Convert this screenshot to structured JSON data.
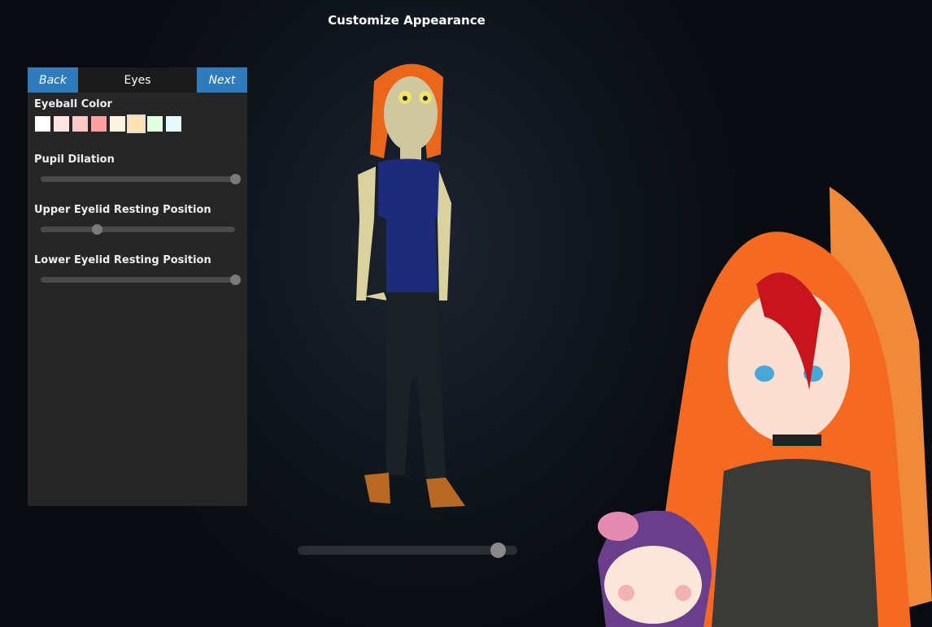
{
  "header": {
    "title": "Customize Appearance"
  },
  "panel": {
    "back_label": "Back",
    "section_title": "Eyes",
    "next_label": "Next",
    "eyeball_color": {
      "label": "Eyeball Color",
      "selected_index": 5,
      "swatches": [
        "#ffffff",
        "#ffe4e4",
        "#ffc8c8",
        "#ff9f9f",
        "#fff3e0",
        "#ffe2b5",
        "#e4ffe4",
        "#e4faff"
      ]
    },
    "sliders": [
      {
        "label": "Pupil Dilation",
        "value": 1.0
      },
      {
        "label": "Upper Eyelid Resting Position",
        "value": 0.29
      },
      {
        "label": "Lower Eyelid Resting Position",
        "value": 1.0
      }
    ]
  },
  "camera_zoom": {
    "value": 0.91
  },
  "colors": {
    "accent": "#2e7bbd",
    "panel": "#262626"
  }
}
